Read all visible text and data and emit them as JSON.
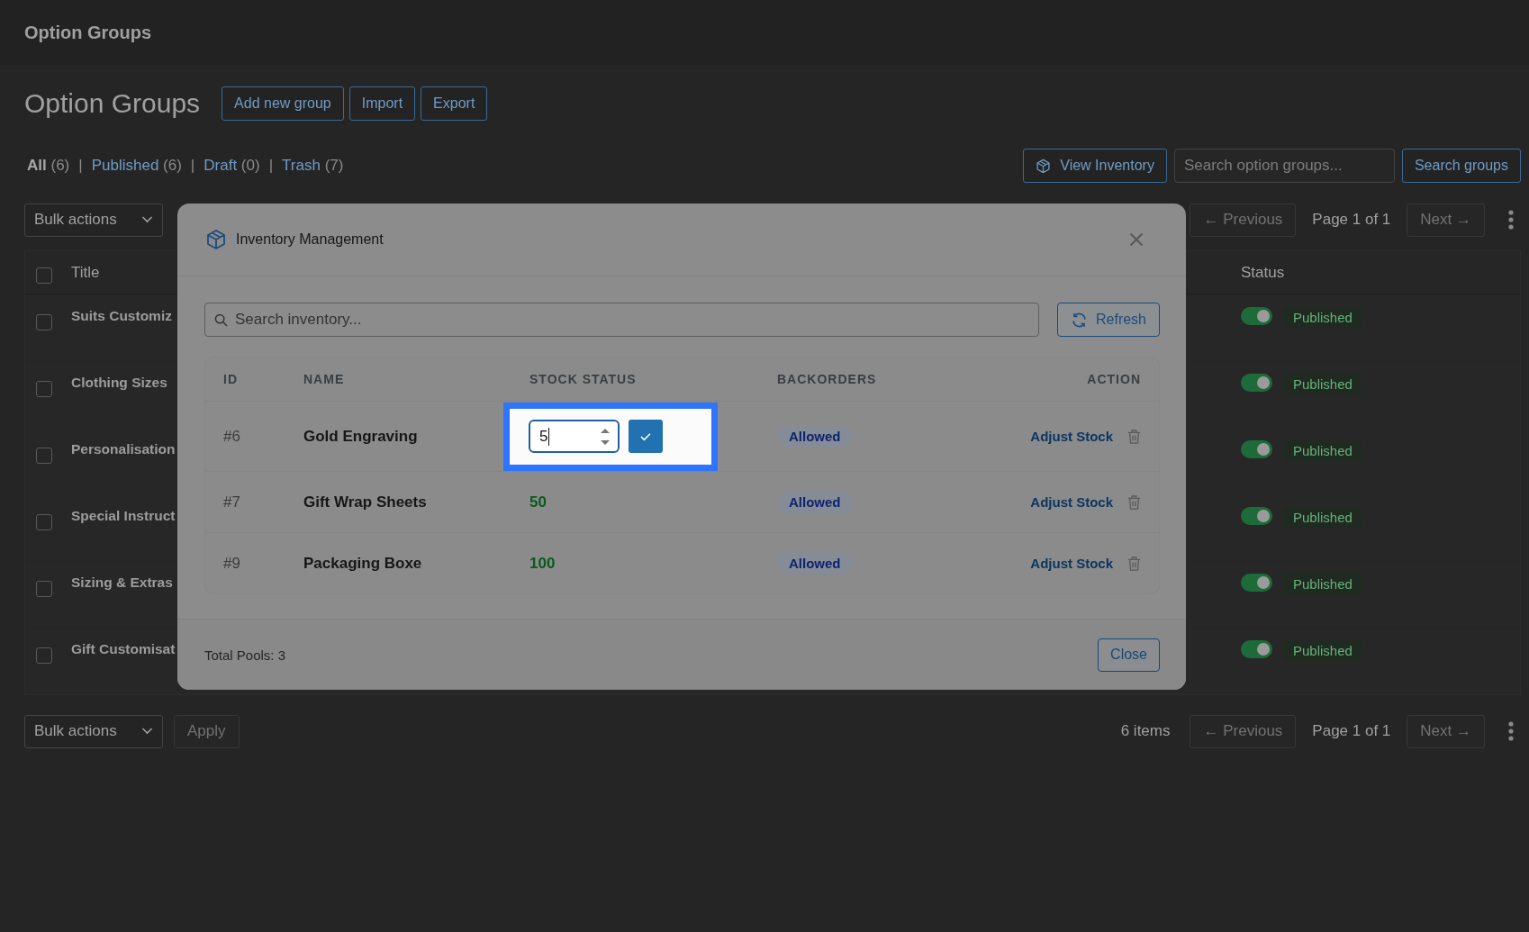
{
  "top_bar": {
    "title": "Option Groups"
  },
  "header": {
    "title": "Option Groups",
    "buttons": [
      "Add new group",
      "Import",
      "Export"
    ]
  },
  "filter_separator": "|",
  "filters": [
    {
      "label": "All",
      "count": "(6)",
      "selected": true
    },
    {
      "label": "Published",
      "count": "(6)",
      "selected": false
    },
    {
      "label": "Draft",
      "count": "(0)",
      "selected": false
    },
    {
      "label": "Trash",
      "count": "(7)",
      "selected": false
    }
  ],
  "toolbar": {
    "view_inventory": "View Inventory",
    "search": {
      "placeholder": "Search option groups..."
    },
    "search_button": "Search groups"
  },
  "top_nav": {
    "bulk_actions": "Bulk actions",
    "pagination": {
      "previous": {
        "label": "← Previous",
        "disabled": true
      },
      "page": "Page 1 of 1",
      "next": {
        "label": "Next →",
        "disabled": true
      }
    }
  },
  "table": {
    "header_checked": false,
    "columns": [
      {
        "label": "Title"
      },
      {
        "label": "Status"
      }
    ],
    "rows": [
      {
        "title": "Suits Customiz",
        "checked": false,
        "published": true,
        "status": "Published"
      },
      {
        "title": "Clothing Sizes",
        "checked": false,
        "published": true,
        "status": "Published"
      },
      {
        "title": "Personalisation",
        "checked": false,
        "published": true,
        "status": "Published"
      },
      {
        "title": "Special Instruct",
        "checked": false,
        "published": true,
        "status": "Published"
      },
      {
        "title": "Sizing & Extras",
        "checked": false,
        "published": true,
        "status": "Published"
      },
      {
        "title": "Gift Customisat",
        "checked": false,
        "published": true,
        "status": "Published"
      }
    ]
  },
  "bottom_nav": {
    "bulk_actions": "Bulk actions",
    "apply": {
      "label": "Apply",
      "disabled": true
    },
    "count": "6 items",
    "pagination": {
      "previous": {
        "label": "← Previous",
        "disabled": true
      },
      "page": "Page 1 of 1",
      "next": {
        "label": "Next →",
        "disabled": true
      }
    }
  },
  "modal": {
    "title": "Inventory Management",
    "search": {
      "placeholder": "Search inventory..."
    },
    "refresh": "Refresh",
    "columns": [
      "ID",
      "NAME",
      "STOCK STATUS",
      "BACKORDERS",
      "ACTION"
    ],
    "rows": [
      {
        "id": "#6",
        "name": "Gold Engraving",
        "stock": {
          "kind": "editing",
          "value": "5",
          "highlighted": true
        },
        "backorders": "Allowed",
        "action": "Adjust Stock"
      },
      {
        "id": "#7",
        "name": "Gift Wrap Sheets",
        "stock": {
          "kind": "text",
          "value": "50"
        },
        "backorders": "Allowed",
        "action": "Adjust Stock"
      },
      {
        "id": "#9",
        "name": "Packaging Boxe",
        "stock": {
          "kind": "text",
          "value": "100"
        },
        "backorders": "Allowed",
        "action": "Adjust Stock"
      }
    ],
    "footer": "Total Pools: 3",
    "close": "Close"
  }
}
